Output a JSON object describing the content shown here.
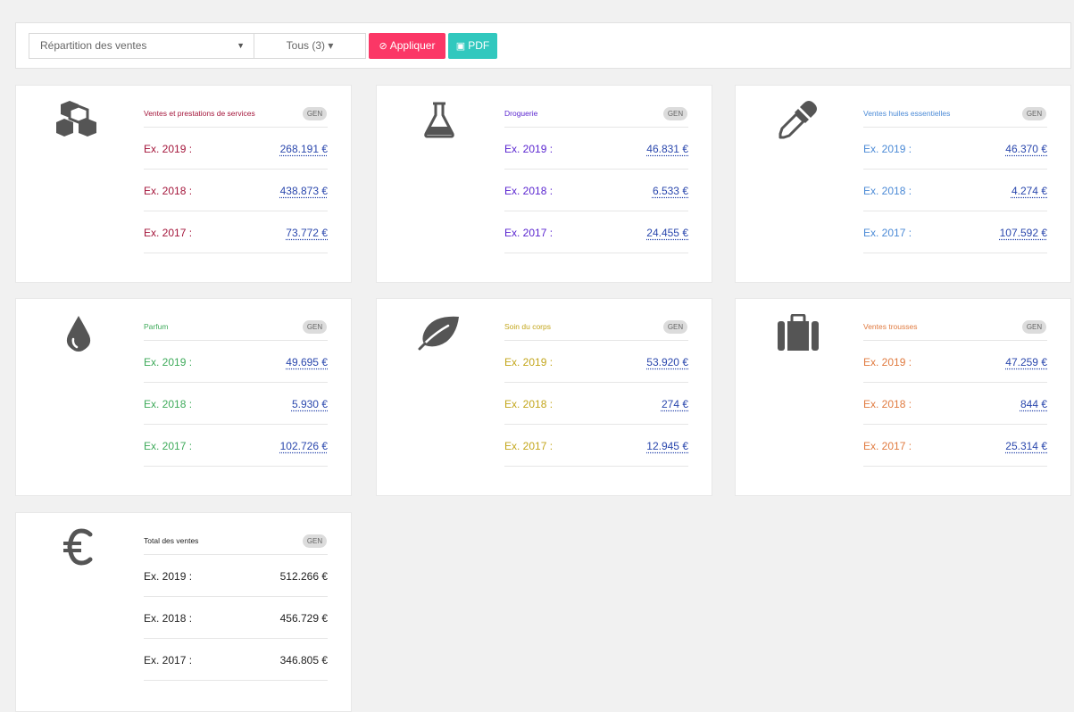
{
  "toolbar": {
    "select_value": "Répartition des ventes",
    "dropdown_label": "Tous (3) ▾",
    "apply_label": "Appliquer",
    "pdf_label": "PDF"
  },
  "colors": {
    "ventes": "#a4163b",
    "droguerie": "#5b26d0",
    "huiles": "#4b8ad6",
    "parfum": "#3eaa5a",
    "soin": "#c3a61b",
    "trousses": "#e07a3f",
    "total": "#222222"
  },
  "cards": [
    {
      "icon": "cubes-icon",
      "title": "Ventes et prestations de services",
      "badge": "GEN",
      "rows": [
        {
          "label": "Ex. 2019 :",
          "value": "268.191 €"
        },
        {
          "label": "Ex. 2018 :",
          "value": "438.873 €"
        },
        {
          "label": "Ex. 2017 :",
          "value": "73.772 €"
        }
      ]
    },
    {
      "icon": "flask-icon",
      "title": "Droguerie",
      "badge": "GEN",
      "rows": [
        {
          "label": "Ex. 2019 :",
          "value": "46.831 €"
        },
        {
          "label": "Ex. 2018 :",
          "value": "6.533 €"
        },
        {
          "label": "Ex. 2017 :",
          "value": "24.455 €"
        }
      ]
    },
    {
      "icon": "eyedropper-icon",
      "title": "Ventes huiles essentielles",
      "badge": "GEN",
      "rows": [
        {
          "label": "Ex. 2019 :",
          "value": "46.370 €"
        },
        {
          "label": "Ex. 2018 :",
          "value": "4.274 €"
        },
        {
          "label": "Ex. 2017 :",
          "value": "107.592 €"
        }
      ]
    },
    {
      "icon": "drop-icon",
      "title": "Parfum",
      "badge": "GEN",
      "rows": [
        {
          "label": "Ex. 2019 :",
          "value": "49.695 €"
        },
        {
          "label": "Ex. 2018 :",
          "value": "5.930 €"
        },
        {
          "label": "Ex. 2017 :",
          "value": "102.726 €"
        }
      ]
    },
    {
      "icon": "leaf-icon",
      "title": "Soin du corps",
      "badge": "GEN",
      "rows": [
        {
          "label": "Ex. 2019 :",
          "value": "53.920 €"
        },
        {
          "label": "Ex. 2018 :",
          "value": "274 €"
        },
        {
          "label": "Ex. 2017 :",
          "value": "12.945 €"
        }
      ]
    },
    {
      "icon": "suitcase-icon",
      "title": "Ventes trousses",
      "badge": "GEN",
      "rows": [
        {
          "label": "Ex. 2019 :",
          "value": "47.259 €"
        },
        {
          "label": "Ex. 2018 :",
          "value": "844 €"
        },
        {
          "label": "Ex. 2017 :",
          "value": "25.314 €"
        }
      ]
    },
    {
      "icon": "euro-icon",
      "title": "Total des ventes",
      "badge": "GEN",
      "rows": [
        {
          "label": "Ex. 2019 :",
          "value": "512.266 €"
        },
        {
          "label": "Ex. 2018 :",
          "value": "456.729 €"
        },
        {
          "label": "Ex. 2017 :",
          "value": "346.805 €"
        }
      ]
    }
  ]
}
